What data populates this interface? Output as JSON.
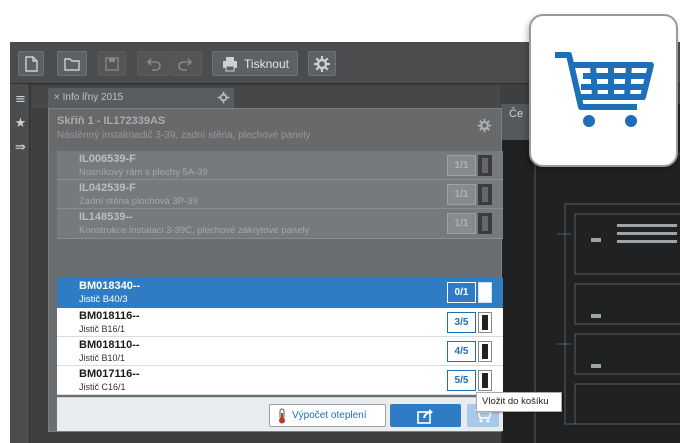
{
  "toolbar": {
    "print_label": "Tisknout"
  },
  "tab": {
    "label": "Info lřny 2015"
  },
  "drawing": {
    "tab_label": "Če"
  },
  "panel": {
    "title": "Skříň 1 - IL172339AS",
    "subtitle": "Nástěnný instalroadič 3-39, zadní stěna, plechové panely",
    "dim_rows": [
      {
        "code": "IL006539-F",
        "desc": "Nosníkový rám s plechy 5A-39",
        "qty": "1/1"
      },
      {
        "code": "IL042539-F",
        "desc": "Zadní stěna plochová 3P-39",
        "qty": "1/1"
      },
      {
        "code": "IL148539--",
        "desc": "Konstrukce instalaci 3-39C, plechové zákrytové panely",
        "qty": "1/1"
      }
    ],
    "rows": [
      {
        "code": "BM018340--",
        "desc": "Jistič  B40/3",
        "qty": "0/1"
      },
      {
        "code": "BM018116--",
        "desc": "Jistič  B16/1",
        "qty": "3/5"
      },
      {
        "code": "BM018110--",
        "desc": "Jistič  B10/1",
        "qty": "4/5"
      },
      {
        "code": "BM017116--",
        "desc": "Jistič  C16/1",
        "qty": "5/5"
      }
    ],
    "calc_label": "Výpočet oteplení",
    "tooltip": "Vložit do košíku"
  },
  "colors": {
    "accent": "#2f7cc5",
    "cart_icon": "#1e6eb8"
  }
}
